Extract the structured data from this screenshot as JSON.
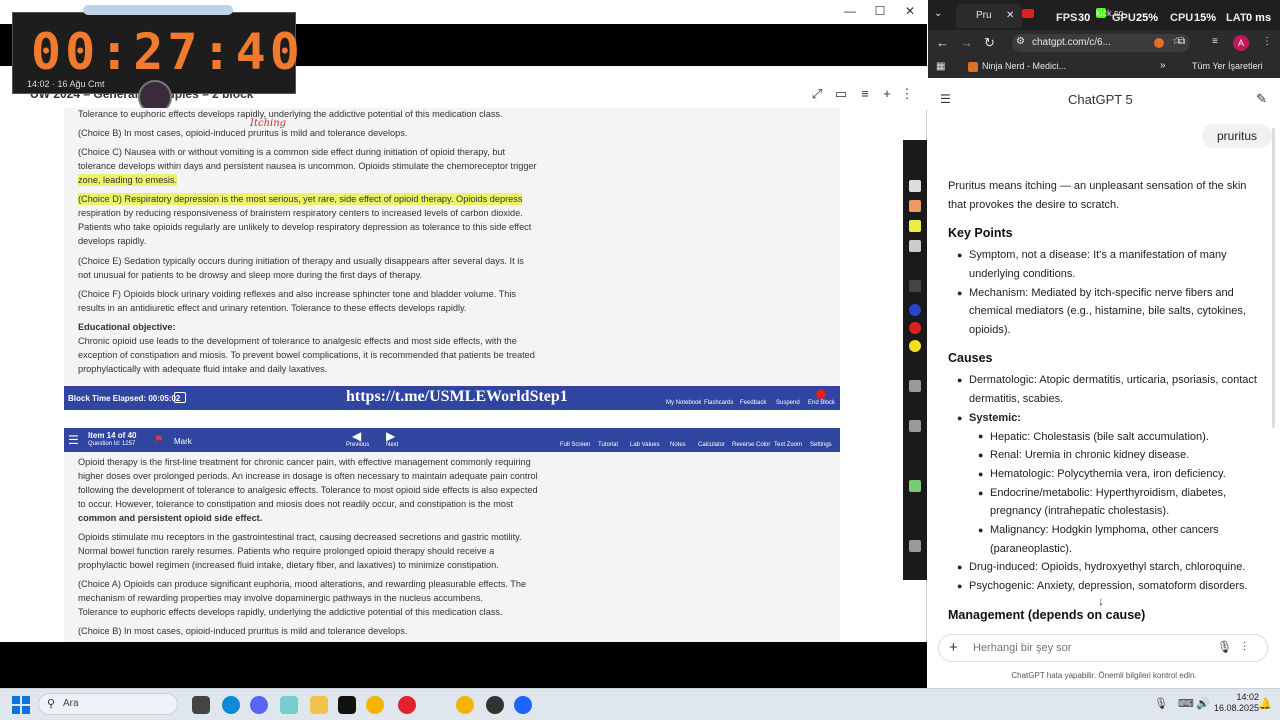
{
  "left_app": {
    "timer": "00:27:40",
    "timer_sub": "14:02 · 16 Ağu Cmt",
    "doc_title": "UW 2024 – General Principles – 2 block",
    "window_controls": {
      "minimize": "—",
      "maximize": "☐",
      "close": "✕"
    }
  },
  "explanation_top": {
    "lines": [
      "Tolerance to euphoric effects develops rapidly, underlying the addictive potential of this medication class.",
      "(Choice B)  In most cases, opioid-induced pruritus is mild and tolerance develops.",
      "(Choice C)  Nausea with or without vomiting is a common side effect during initiation of opioid therapy, but",
      "tolerance develops within days and persistent nausea is uncommon.  Opioids stimulate the chemoreceptor trigger",
      "zone, leading to emesis.",
      "(Choice D)  Respiratory depression is the most serious, yet rare, side effect of opioid therapy.  Opioids depress",
      "respiration by reducing responsiveness of brainstem respiratory centers to increased levels of carbon dioxide.",
      "Patients who take opioids regularly are unlikely to develop respiratory depression as tolerance to this side effect",
      "develops rapidly.",
      "(Choice E)  Sedation typically occurs during initiation of therapy and usually disappears after several days.  It is",
      "not unusual for patients to be drowsy and sleep more during the first days of therapy.",
      "(Choice F)  Opioids block urinary voiding reflexes and also increase sphincter tone and bladder volume.  This",
      "results in an antidiuretic effect and urinary retention.  Tolerance to these effects develops rapidly.",
      "Educational objective:",
      "Chronic opioid use leads to the development of tolerance to analgesic effects and most side effects, with the",
      "exception of constipation and miosis.  To prevent bowel complications, it is recommended that patients be treated",
      "prophylactically with adequate fluid intake and daily laxatives."
    ],
    "handwritten": "Itching"
  },
  "bottom_bar": {
    "block_time": "Block Time Elapsed: 00:05:02",
    "url": "https://t.me/USMLEWorldStep1",
    "buttons": [
      "My Notebook",
      "Flashcards",
      "Feedback",
      "Suspend",
      "End Block"
    ]
  },
  "top_bar": {
    "item": "Item 14 of 40",
    "question_id": "Question Id: 1257",
    "mark": "Mark",
    "nav": [
      "Previous",
      "Next"
    ],
    "tools": [
      "Full Screen",
      "Tutorial",
      "Lab Values",
      "Notes",
      "Calculator",
      "Reverse Color",
      "Text Zoom",
      "Settings"
    ]
  },
  "explanation_bottom": {
    "lines": [
      "Opioid therapy is the first-line treatment for chronic cancer pain, with effective management commonly requiring",
      "higher doses over prolonged periods.  An increase in dosage is often necessary to maintain adequate pain control",
      "following the development of tolerance to analgesic effects.  Tolerance to most opioid side effects is also expected",
      "to occur.  However, tolerance to constipation and miosis does not readily occur, and constipation is the most",
      "common and persistent opioid side effect.",
      "Opioids stimulate mu receptors in the gastrointestinal tract, causing decreased secretions and gastric motility.",
      "Normal bowel function rarely resumes.  Patients who require prolonged opioid therapy should receive a",
      "prophylactic bowel regimen (increased fluid intake, dietary fiber, and laxatives) to minimize constipation.",
      "(Choice A)  Opioids can produce significant euphoria, mood alterations, and rewarding pleasurable effects.  The",
      "mechanism of rewarding properties may involve dopaminergic pathways in the nucleus accumbens.",
      "Tolerance to euphoric effects develops rapidly, underlying the addictive potential of this medication class.",
      "(Choice B)  In most cases, opioid-induced pruritus is mild and tolerance develops."
    ]
  },
  "browser": {
    "tab_label": "Pru",
    "overlay": {
      "fps_label": "FPS",
      "fps": "30",
      "gpu_label": "GPU",
      "gpu": "25%",
      "cpu_label": "CPU",
      "cpu": "15%",
      "lat_label": "LAT",
      "lat": "0 ms"
    },
    "address": "chatgpt.com/c/6...",
    "bookmarks": [
      "Ninja Nerd - Medici...",
      "Tüm Yer İşaretleri"
    ],
    "kick_label": "kick.co"
  },
  "chat": {
    "model": "ChatGPT 5",
    "user_msg": "pruritus",
    "intro_1": "Pruritus means itching — an unpleasant sensation of the skin",
    "intro_2": "that provokes the desire to scratch.",
    "kp_heading": "Key Points",
    "kp1_a": "Symptom, not a disease: It's a manifestation of many",
    "kp1_b": "underlying conditions.",
    "kp2_a": "Mechanism: Mediated by itch-specific nerve fibers and",
    "kp2_b": "chemical mediators (e.g., histamine, bile salts, cytokines,",
    "kp2_c": "opioids).",
    "causes_heading": "Causes",
    "c1_a": "Dermatologic: Atopic dermatitis, urticaria, psoriasis, contact",
    "c1_b": "dermatitis, scabies.",
    "c2": "Systemic:",
    "s1": "Hepatic: Cholestasis (bile salt accumulation).",
    "s2": "Renal: Uremia in chronic kidney disease.",
    "s3": "Hematologic: Polycythemia vera, iron deficiency.",
    "s4_a": "Endocrine/metabolic: Hyperthyroidism, diabetes,",
    "s4_b": "pregnancy (intrahepatic cholestasis).",
    "s5_a": "Malignancy: Hodgkin lymphoma, other cancers",
    "s5_b": "(paraneoplastic).",
    "c3": "Drug-induced: Opioids, hydroxyethyl starch, chloroquine.",
    "c4": "Psychogenic: Anxiety, depression, somatoform disorders.",
    "mgmt_heading": "Management (depends on cause)",
    "input_placeholder": "Herhangi bir şey sor",
    "disclaimer": "ChatGPT hata yapabilir. Önemli bilgileri kontrol edin."
  },
  "taskbar": {
    "search": "Ara",
    "time": "14:02",
    "date": "16.08.2025"
  }
}
